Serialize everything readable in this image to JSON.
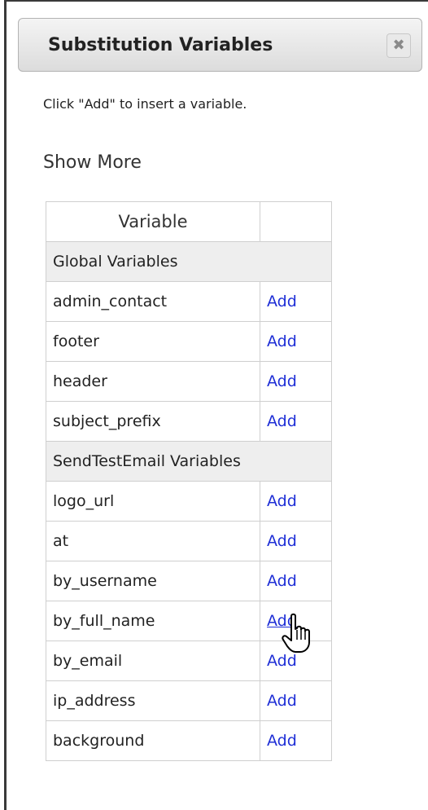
{
  "dialog": {
    "title": "Substitution Variables",
    "close_glyph": "✖",
    "instruction": "Click \"Add\" to insert a variable.",
    "show_more": "Show More"
  },
  "table": {
    "header": {
      "variable": "Variable",
      "action": ""
    },
    "groups": [
      {
        "name": "Global Variables",
        "rows": [
          {
            "name": "admin_contact",
            "action": "Add"
          },
          {
            "name": "footer",
            "action": "Add"
          },
          {
            "name": "header",
            "action": "Add"
          },
          {
            "name": "subject_prefix",
            "action": "Add"
          }
        ]
      },
      {
        "name": "SendTestEmail Variables",
        "rows": [
          {
            "name": "logo_url",
            "action": "Add"
          },
          {
            "name": "at",
            "action": "Add"
          },
          {
            "name": "by_username",
            "action": "Add"
          },
          {
            "name": "by_full_name",
            "action": "Add"
          },
          {
            "name": "by_email",
            "action": "Add"
          },
          {
            "name": "ip_address",
            "action": "Add"
          },
          {
            "name": "background",
            "action": "Add"
          }
        ]
      }
    ]
  },
  "colors": {
    "link": "#1f2fd6",
    "group_bg": "#eeeeee",
    "border": "#cfcfcf"
  },
  "cursor": {
    "icon": "hand-pointer-icon"
  }
}
